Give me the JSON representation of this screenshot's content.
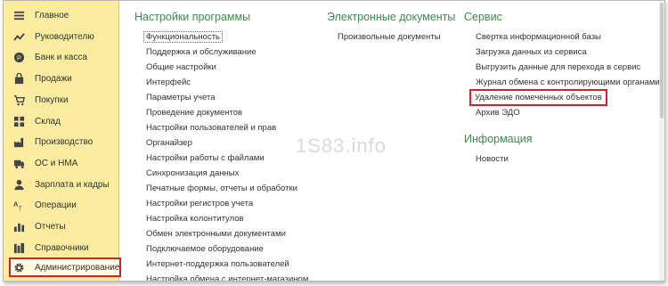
{
  "sidebar": {
    "items": [
      {
        "label": "Главное",
        "icon": "home-icon"
      },
      {
        "label": "Руководителю",
        "icon": "trend-chart-icon"
      },
      {
        "label": "Банк и касса",
        "icon": "coin-icon"
      },
      {
        "label": "Продажи",
        "icon": "shopping-bag-icon"
      },
      {
        "label": "Покупки",
        "icon": "cart-icon"
      },
      {
        "label": "Склад",
        "icon": "warehouse-icon"
      },
      {
        "label": "Производство",
        "icon": "factory-icon"
      },
      {
        "label": "ОС и НМА",
        "icon": "truck-icon"
      },
      {
        "label": "Зарплата и кадры",
        "icon": "person-icon"
      },
      {
        "label": "Операции",
        "icon": "operations-icon"
      },
      {
        "label": "Отчеты",
        "icon": "bar-chart-icon"
      },
      {
        "label": "Справочники",
        "icon": "books-icon"
      },
      {
        "label": "Администрирование",
        "icon": "gear-icon"
      }
    ],
    "active_index": 12
  },
  "columns": {
    "settings": {
      "title": "Настройки программы",
      "links": [
        "Функциональность",
        "Поддержка и обслуживание",
        "Общие настройки",
        "Интерфейс",
        "Параметры учета",
        "Проведение документов",
        "Настройки пользователей и прав",
        "Органайзер",
        "Настройки работы с файлами",
        "Синхронизация данных",
        "Печатные формы, отчеты и обработки",
        "Настройки регистров учета",
        "Настройка колонтитулов",
        "Обмен электронными документами",
        "Подключаемое оборудование",
        "Интернет-поддержка пользователей",
        "Настройка обмена с интернет-магазином"
      ]
    },
    "edocs": {
      "title": "Электронные документы",
      "links": [
        "Произвольные документы"
      ]
    },
    "service": {
      "title": "Сервис",
      "links": [
        "Свертка информационной базы",
        "Загрузка данных из сервиса",
        "Выгрузить данные для перехода в сервис",
        "Журнал обмена с контролирующими органами",
        "Удаление помеченных объектов",
        "Архив ЭДО"
      ]
    },
    "info": {
      "title": "Информация",
      "links": [
        "Новости"
      ]
    }
  },
  "watermark": "1S83.info",
  "colors": {
    "sidebar_bg": "#fbeca0",
    "section_title": "#3f8a4e",
    "highlight_border": "#d3212c"
  }
}
